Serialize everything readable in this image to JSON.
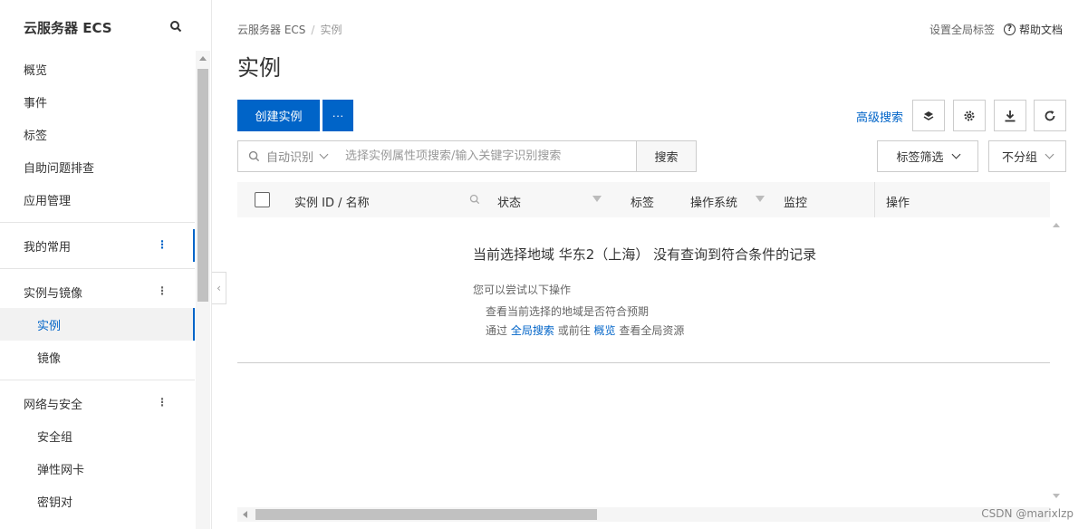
{
  "sidebar": {
    "title": "云服务器 ECS",
    "items": [
      {
        "label": "概览"
      },
      {
        "label": "事件"
      },
      {
        "label": "标签"
      },
      {
        "label": "自助问题排查"
      },
      {
        "label": "应用管理"
      }
    ],
    "favorites": {
      "label": "我的常用"
    },
    "instances_group": {
      "label": "实例与镜像",
      "children": [
        {
          "label": "实例"
        },
        {
          "label": "镜像"
        }
      ]
    },
    "network_group": {
      "label": "网络与安全",
      "children": [
        {
          "label": "安全组"
        },
        {
          "label": "弹性网卡"
        },
        {
          "label": "密钥对"
        }
      ]
    }
  },
  "breadcrumb": {
    "root": "云服务器 ECS",
    "sep": "/",
    "current": "实例"
  },
  "top_links": {
    "global_tags": "设置全局标签",
    "help": "帮助文档"
  },
  "page_title": "实例",
  "toolbar": {
    "create_label": "创建实例",
    "more_label": "···",
    "advanced_search": "高级搜索"
  },
  "search": {
    "mode_label": "自动识别",
    "placeholder": "选择实例属性项搜索/输入关键字识别搜索",
    "button": "搜索",
    "tag_filter": "标签筛选",
    "group_select": "不分组"
  },
  "table": {
    "columns": {
      "id_name": "实例 ID / 名称",
      "status": "状态",
      "tags": "标签",
      "os": "操作系统",
      "monitor": "监控",
      "actions": "操作"
    },
    "empty": {
      "title": "当前选择地域 华东2（上海） 没有查询到符合条件的记录",
      "hint": "您可以尝试以下操作",
      "line1": "查看当前选择的地域是否符合预期",
      "line2_prefix": "通过",
      "line2_link1": "全局搜索",
      "line2_mid": "或前往",
      "line2_link2": "概览",
      "line2_suffix": "查看全局资源"
    }
  },
  "watermark": "CSDN @marixlzp",
  "colors": {
    "accent": "#0064c8"
  }
}
